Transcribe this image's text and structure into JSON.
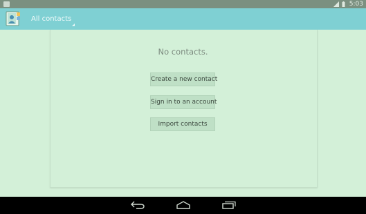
{
  "status_bar": {
    "time": "5:03"
  },
  "action_bar": {
    "title": "All contacts"
  },
  "empty_state": {
    "message": "No contacts.",
    "buttons": [
      {
        "label": "Create a new contact"
      },
      {
        "label": "Sign in to an account"
      },
      {
        "label": "Import contacts"
      }
    ]
  },
  "nav_bar": {
    "icons": [
      "back-icon",
      "home-icon",
      "recents-icon"
    ]
  }
}
